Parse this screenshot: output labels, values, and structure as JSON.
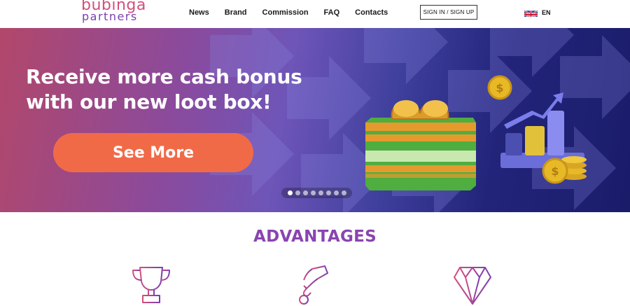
{
  "logo": {
    "line1": "bubinga",
    "line2": "partners"
  },
  "nav": {
    "items": [
      "News",
      "Brand",
      "Commission",
      "FAQ",
      "Contacts"
    ]
  },
  "auth": {
    "signin_label": "SIGN IN / SIGN UP"
  },
  "language": {
    "label": "EN"
  },
  "banner": {
    "headline": "Receive more cash bonus with our new loot box!",
    "cta_label": "See More",
    "slide_count": 8,
    "active_slide": 1
  },
  "advantages": {
    "title": "ADVANTAGES",
    "icons": [
      "trophy-icon",
      "hand-coin-icon",
      "diamond-icon"
    ]
  },
  "colors": {
    "accent": "#8a44b0",
    "cta": "#f16a48",
    "logo_pink": "#d24f7c"
  }
}
